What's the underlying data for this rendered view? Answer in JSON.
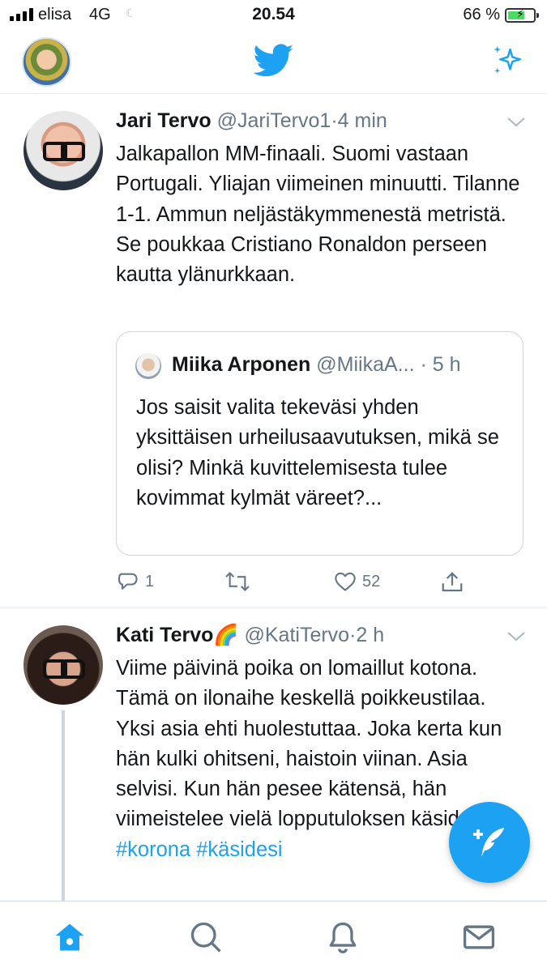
{
  "status_bar": {
    "carrier": "elisa",
    "network": "4G",
    "time": "20.54",
    "battery_percent_label": "66 %",
    "battery_level": 0.66,
    "signal_bars": 4
  },
  "colors": {
    "accent": "#1da1f2",
    "secondary_text": "#657786",
    "divider": "#e6ecf0"
  },
  "top_nav": {
    "left_icon": "profile-avatar",
    "center_icon": "twitter-bird-icon",
    "right_icon": "sparkle-icon"
  },
  "tweets": [
    {
      "name": "Jari Tervo",
      "handle": "@JariTervo1",
      "separator": "·",
      "time": "4 min",
      "text": "Jalkapallon MM-finaali. Suomi vastaan Portugali. Yliajan viimeinen minuutti. Tilanne 1-1. Ammun neljästäkymmenestä metristä. Se poukkaa Cristiano Ronaldon perseen kautta ylänurkkaan.",
      "quote": {
        "name": "Miika Arponen",
        "handle": "@MiikaA...",
        "separator": "·",
        "time": "5 h",
        "text": "Jos saisit valita tekeväsi yhden yksittäisen urheilusaavutuksen, mikä se olisi? Minkä kuvittelemisesta tulee kovimmat kylmät väreet?..."
      },
      "actions": {
        "reply_count": "1",
        "retweet_count": "",
        "like_count": "52"
      }
    },
    {
      "name": "Kati Tervo",
      "name_emoji": "🌈",
      "handle": "@KatiTervo",
      "separator": "·",
      "time": "2 h",
      "text": "Viime päivinä poika on lomaillut kotona. Tämä on ilonaihe keskellä poikkeustilaa. Yksi asia ehti huolestuttaa. Joka kerta kun hän kulki ohitseni, haistoin viinan. Asia selvisi. Kun hän pesee kätensä, hän viimeistelee vielä lopputuloksen käsidesillä.",
      "hashtags": " #korona #käsidesi"
    }
  ],
  "tab_bar": [
    "home-icon",
    "search-icon",
    "notifications-icon",
    "messages-icon"
  ]
}
